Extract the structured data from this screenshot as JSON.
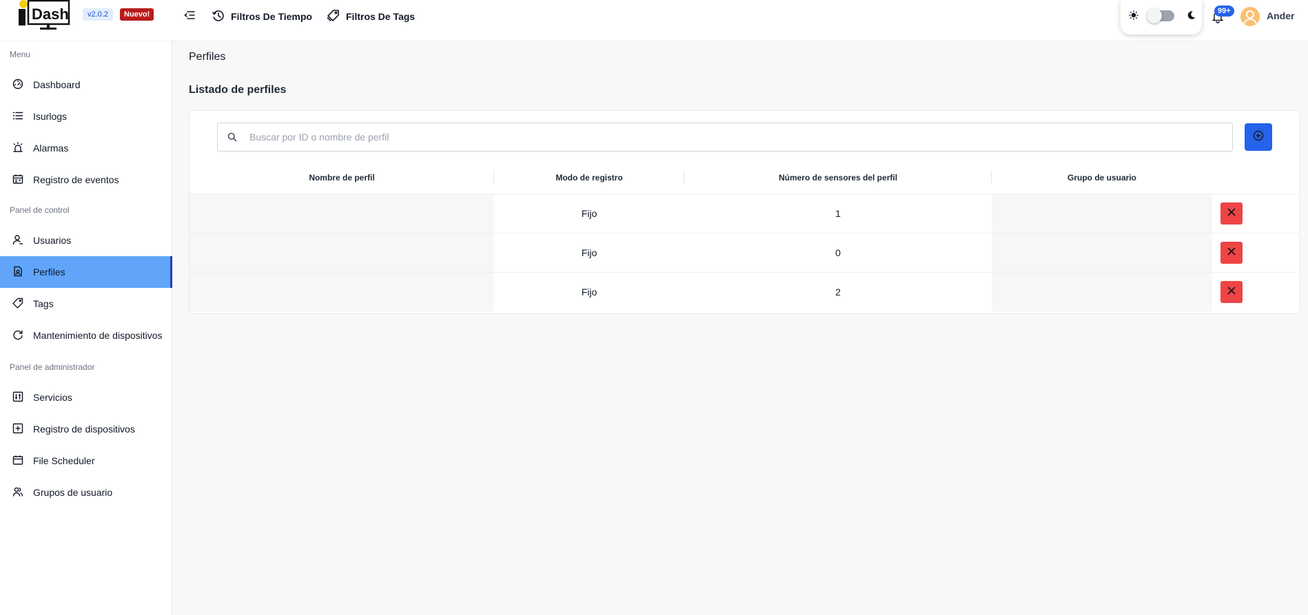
{
  "header": {
    "version": "v2.0.2",
    "new_badge": "Nuevo!",
    "nav": [
      {
        "label": "Filtros De Tiempo",
        "icon": "history-icon"
      },
      {
        "label": "Filtros De Tags",
        "icon": "tag-icon"
      }
    ],
    "notifications": "99+",
    "user": "Ander",
    "theme": "light"
  },
  "logo": {
    "text": "Dash"
  },
  "sidebar": {
    "sections": [
      "Menu",
      "Panel de control",
      "Panel de administrador"
    ],
    "items": [
      {
        "label": "Dashboard",
        "icon": "dashboard-gauge-icon"
      },
      {
        "label": "Isurlogs",
        "icon": "list-icon"
      },
      {
        "label": "Alarmas",
        "icon": "alarm-siren-icon"
      },
      {
        "label": "Registro de eventos",
        "icon": "calendar-events-icon"
      },
      {
        "label": "Usuarios",
        "icon": "user-icon"
      },
      {
        "label": "Perfiles",
        "icon": "profile-document-icon",
        "active": true
      },
      {
        "label": "Tags",
        "icon": "tag-icon"
      },
      {
        "label": "Mantenimiento de dispositivos",
        "icon": "refresh-icon"
      },
      {
        "label": "Servicios",
        "icon": "sliders-icon"
      },
      {
        "label": "Registro de dispositivos",
        "icon": "plus-square-icon"
      },
      {
        "label": "File Scheduler",
        "icon": "calendar-icon"
      },
      {
        "label": "Grupos de usuario",
        "icon": "user-group-icon"
      }
    ]
  },
  "main": {
    "title": "Perfiles",
    "subtitle": "Listado de perfiles",
    "search": {
      "placeholder": "Buscar por ID o nombre de perfil",
      "value": ""
    },
    "table": {
      "columns": [
        "Nombre de perfil",
        "Modo de registro",
        "Número de sensores del perfil",
        "Grupo de usuario"
      ],
      "rows": [
        {
          "nombre": "",
          "modo": "Fijo",
          "sensores": "1",
          "grupo": ""
        },
        {
          "nombre": "",
          "modo": "Fijo",
          "sensores": "0",
          "grupo": ""
        },
        {
          "nombre": "",
          "modo": "Fijo",
          "sensores": "2",
          "grupo": ""
        }
      ]
    }
  },
  "colors": {
    "primary": "#2563eb",
    "active_item": "#60a5fa",
    "danger": "#ef4444",
    "new_badge": "#b91c1c"
  }
}
